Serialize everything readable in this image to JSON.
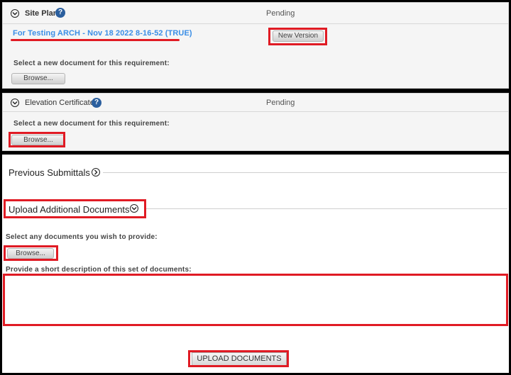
{
  "site_plan": {
    "title": "Site Plan",
    "help": "?",
    "status": "Pending",
    "file_link": "For Testing ARCH - Nov 18 2022 8-16-52 (TRUE)",
    "new_version_label": "New Version",
    "select_prompt": "Select a new document for this requirement:",
    "browse_label": "Browse..."
  },
  "elevation_certificate": {
    "title": "Elevation Certificate",
    "help": "?",
    "status": "Pending",
    "select_prompt": "Select a new document for this requirement:",
    "browse_label": "Browse..."
  },
  "previous_submittals": {
    "title": "Previous Submittals"
  },
  "upload_additional": {
    "title": "Upload Additional Documents",
    "select_prompt": "Select any documents you wish to provide:",
    "browse_label": "Browse...",
    "description_label": "Provide a short description of this set of documents:",
    "description_value": "",
    "upload_button_label": "UPLOAD DOCUMENTS"
  },
  "colors": {
    "highlight": "#e01b24",
    "link": "#3a8ee6",
    "help_badge": "#2b5f9e"
  }
}
